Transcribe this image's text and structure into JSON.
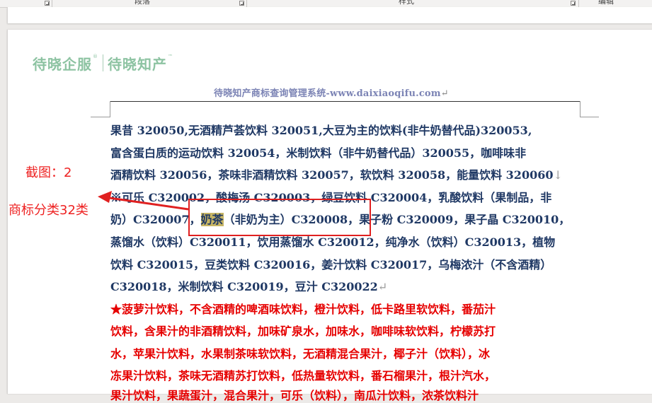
{
  "ribbon": {
    "groups": [
      "段落",
      "样式",
      "编辑"
    ]
  },
  "logo": {
    "brand_a": "待晓企服",
    "brand_b": "待晓知产"
  },
  "header": {
    "text": "待晓知产商标查询管理系统-www.daixiaoqifu.com"
  },
  "body": {
    "lines": [
      "果昔 320050,无酒精芦荟饮料 320051,大豆为主的饮料(非牛奶替代品)320053,",
      "富含蛋白质的运动饮料 320054，米制饮料（非牛奶替代品）320055，咖啡味非",
      "酒精饮料 320056，茶味非酒精饮料 320057，软饮料 320058，能量饮料 320060",
      "※可乐 C320002，酸梅汤 C320003，绿豆饮料 C320004，乳酸饮料（果制品，非",
      "（非奶为主）C320008，果子粉 C320009，果子晶 C320010，",
      "蒸馏水（饮料）C320011，饮用蒸馏水 C320012，纯净水（饮料）C320013，植物",
      "饮料 C320015，豆类饮料 C320016，姜汁饮料 C320017，乌梅浓汁（不含酒精）",
      "C320018，米制饮料 C320019，豆汁 C320022"
    ],
    "line5_prefix": "奶）C320007，",
    "highlight": "奶茶",
    "red_lines": [
      "★菠萝汁饮料，不含酒精的啤酒味饮料，橙汁饮料，低卡路里软饮料，番茄汁",
      "饮料，含果汁的非酒精饮料，加味矿泉水，加味水，咖啡味软饮料，柠檬苏打",
      "水，苹果汁饮料，水果制茶味软饮料，无酒精混合果汁，椰子汁（饮料），冰",
      "冻果汁饮料，茶味无酒精苏打饮料，低热量软饮料，番石榴果汁，根汁汽水，",
      "果汁饮料，果蔬蛋汁，混合果汁，可乐（饮料），南瓜汁饮料，浓茶饮料汁"
    ]
  },
  "annotations": {
    "screenshot_label": "截图：2",
    "class_label": "商标分类32类"
  }
}
